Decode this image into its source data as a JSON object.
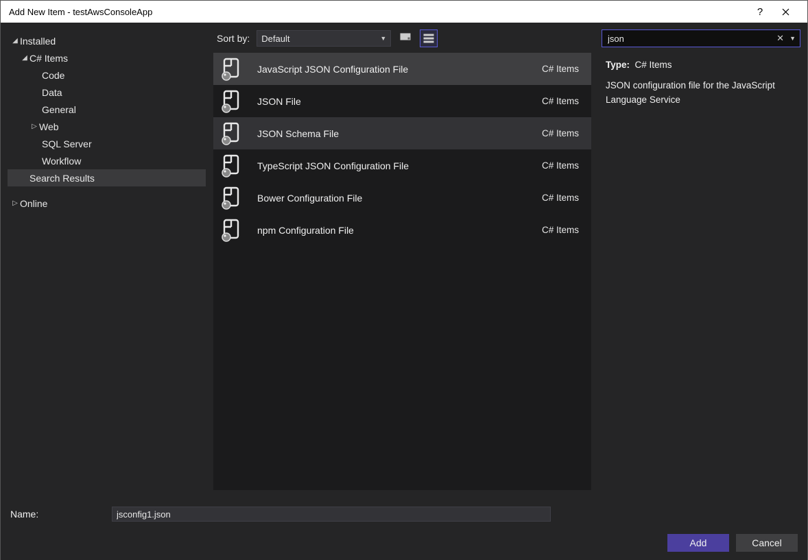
{
  "window": {
    "title": "Add New Item - testAwsConsoleApp"
  },
  "sidebar": {
    "installed": "Installed",
    "csharp_items": "C# Items",
    "items": {
      "code": "Code",
      "data": "Data",
      "general": "General",
      "web": "Web",
      "sql_server": "SQL Server",
      "workflow": "Workflow"
    },
    "search_results": "Search Results",
    "online": "Online"
  },
  "toolbar": {
    "sort_by_label": "Sort by:",
    "sort_value": "Default"
  },
  "search": {
    "value": "json"
  },
  "templates": [
    {
      "name": "JavaScript JSON Configuration File",
      "category": "C# Items",
      "state": "selected"
    },
    {
      "name": "JSON File",
      "category": "C# Items",
      "state": ""
    },
    {
      "name": "JSON Schema File",
      "category": "C# Items",
      "state": "hover"
    },
    {
      "name": "TypeScript JSON Configuration File",
      "category": "C# Items",
      "state": ""
    },
    {
      "name": "Bower Configuration File",
      "category": "C# Items",
      "state": ""
    },
    {
      "name": "npm Configuration File",
      "category": "C# Items",
      "state": ""
    }
  ],
  "details": {
    "type_label": "Type:",
    "type_value": "C# Items",
    "description": "JSON configuration file for the JavaScript Language Service"
  },
  "footer": {
    "name_label": "Name:",
    "name_value": "jsconfig1.json",
    "add_label": "Add",
    "cancel_label": "Cancel"
  }
}
